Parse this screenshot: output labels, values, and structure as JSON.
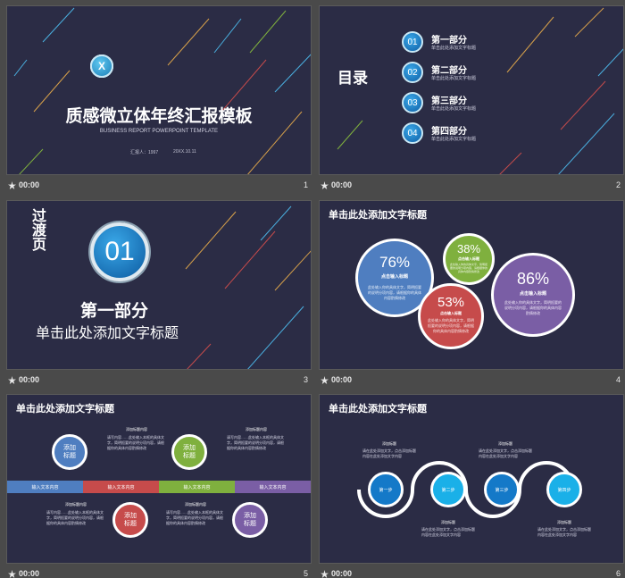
{
  "footer_time": "00:00",
  "slide1": {
    "year_chars": [
      "2",
      "0",
      "X",
      "X"
    ],
    "title": "质感微立体年终汇报模板",
    "subtitle": "BUSINESS REPORT POWERPOINT TEMPLATE",
    "reporter": "汇报人：1997",
    "date": "20XX.10.11",
    "num": "1"
  },
  "slide2": {
    "heading": "目录",
    "items": [
      {
        "num": "01",
        "title": "第一部分",
        "sub": "单击此处添加文字标题"
      },
      {
        "num": "02",
        "title": "第二部分",
        "sub": "单击此处添加文字标题"
      },
      {
        "num": "03",
        "title": "第三部分",
        "sub": "单击此处添加文字标题"
      },
      {
        "num": "04",
        "title": "第四部分",
        "sub": "单击此处添加文字标题"
      }
    ],
    "num": "2"
  },
  "slide3": {
    "vertical": "过渡页",
    "badge": "01",
    "title": "第一部分",
    "subtitle": "单击此处添加文字标题",
    "num": "3"
  },
  "slide4": {
    "title": "单击此处添加文字标题",
    "bubbles": [
      {
        "pct": "76%",
        "label": "点击输入标题",
        "text": "此处输入你的具体文字，简明扼要的说明分项内容，请根据你的具体内容酌情修改",
        "color": "#4f7ec0"
      },
      {
        "pct": "38%",
        "label": "点击输入标题",
        "text": "此处输入你的具体文字，简明扼要的说明分项内容，请根据你的具体内容酌情修改",
        "color": "#7fb03e"
      },
      {
        "pct": "53%",
        "label": "点击输入标题",
        "text": "此处输入你的具体文字，简明扼要的说明分项内容，请根据你的具体内容酌情修改",
        "color": "#c64b4b"
      },
      {
        "pct": "86%",
        "label": "点击输入标题",
        "text": "此处输入你的具体文字，简明扼要的说明分项内容，请根据你的具体内容酌情修改",
        "color": "#7a5ea5"
      }
    ],
    "num": "4"
  },
  "slide5": {
    "title": "单击此处添加文字标题",
    "circle_label": "添加标题",
    "content_title": "添加标题内容",
    "content_text": "请写内容……此处输入本框的具体文字，简明扼要的说明分项内容，请根据你的具体内容酌情修改",
    "bar_label": "输入文本内容",
    "colors": [
      "#4f7ec0",
      "#c64b4b",
      "#7fb03e",
      "#7a5ea5"
    ],
    "num": "5"
  },
  "slide6": {
    "title": "单击此处添加文字标题",
    "steps": [
      "第一步",
      "第二步",
      "第三步",
      "第四步"
    ],
    "caption_title": "添加标题",
    "caption_text": "请在此处添加文字，点击添加标题内容在此处添加文字内容",
    "num": "6"
  }
}
